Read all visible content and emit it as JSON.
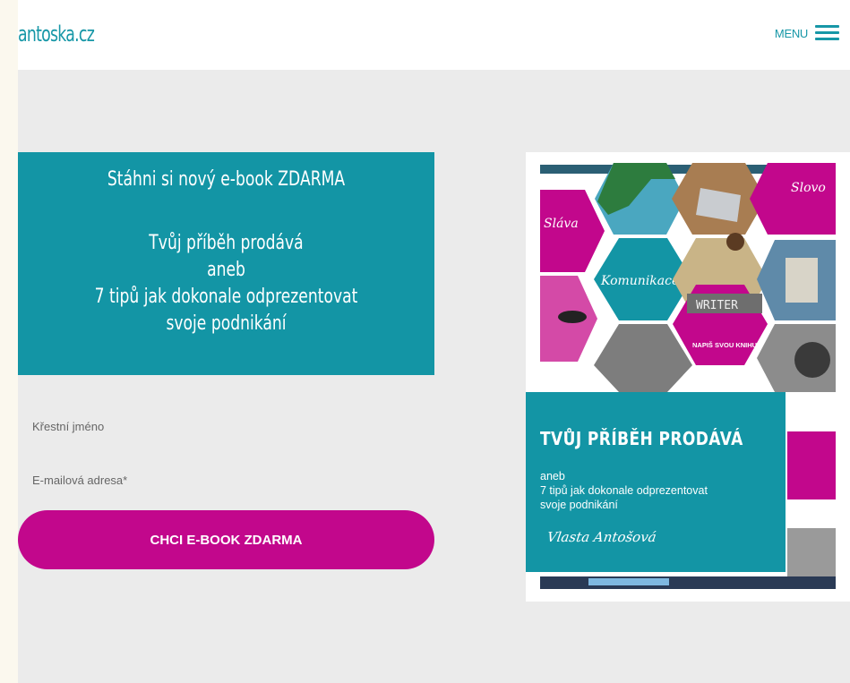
{
  "header": {
    "logo": "antoska.cz",
    "menu_label": "MENU"
  },
  "promo": {
    "line1": "Stáhni si nový e-book ZDARMA",
    "title_lines": [
      "Tvůj příběh prodává",
      "aneb",
      "7 tipů jak dokonale odprezentovat",
      "svoje podnikání"
    ]
  },
  "form": {
    "first_name_label": "Křestní jméno",
    "email_label": "E-mailová adresa*",
    "submit_label": "CHCI E-BOOK ZDARMA"
  },
  "cover": {
    "title": "TVŮJ PŘÍBĚH PRODÁVÁ",
    "subtitle_lines": [
      "aneb",
      "7 tipů jak dokonale odprezentovat",
      "svoje podnikání"
    ],
    "author": "Vlasta Antošová",
    "hex_labels": {
      "slovo": "Slovo",
      "slava": "Sláva",
      "komunikace": "Komunikace",
      "writer": "WRITER",
      "napis": "NAPIŠ SVOU KNIHU"
    }
  },
  "colors": {
    "teal": "#1395a5",
    "magenta": "#c2078c",
    "page_bg": "#ebebeb"
  }
}
